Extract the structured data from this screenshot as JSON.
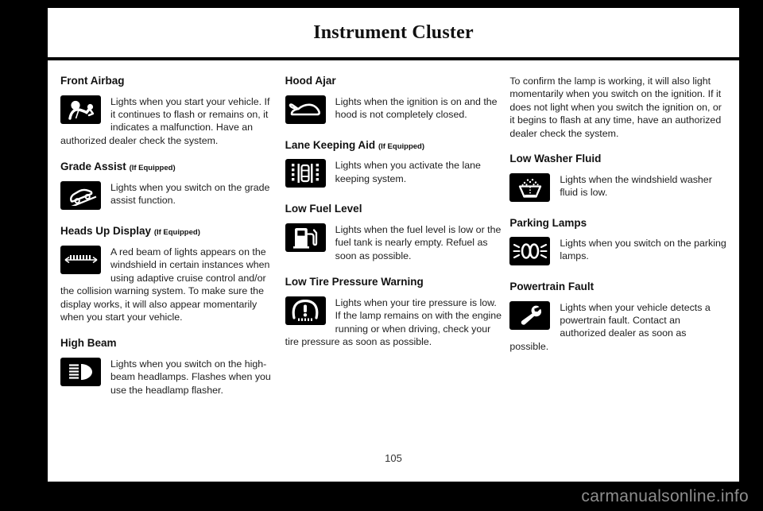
{
  "header": {
    "title": "Instrument Cluster"
  },
  "page_number": "105",
  "watermark": "carmanualsonline.info",
  "columns": [
    {
      "name": "column-1",
      "blocks": [
        {
          "heading": "Front Airbag",
          "if_equipped": "",
          "icon": "airbag-icon",
          "text": "Lights when you start your vehicle. If it continues to flash or remains on, it indicates a malfunction. Have an authorized dealer check the system."
        },
        {
          "heading": "Grade Assist",
          "if_equipped": "(If Equipped)",
          "icon": "grade-assist-icon",
          "text": "Lights when you switch on the grade assist function."
        },
        {
          "heading": "Heads Up Display",
          "if_equipped": "(If Equipped)",
          "icon": "heads-up-display-icon",
          "text": "A red beam of lights appears on the windshield in certain instances when using adaptive cruise control and/or the collision warning system. To make sure the display works, it will also appear momentarily when you start your vehicle."
        },
        {
          "heading": "High Beam",
          "if_equipped": "",
          "icon": "high-beam-icon",
          "text": "Lights when you switch on the high-beam headlamps. Flashes when you use the headlamp flasher."
        }
      ]
    },
    {
      "name": "column-2",
      "blocks": [
        {
          "heading": "Hood Ajar",
          "if_equipped": "",
          "icon": "hood-ajar-icon",
          "text": "Lights when the ignition is on and the hood is not completely closed."
        },
        {
          "heading": "Lane Keeping Aid",
          "if_equipped": "(If Equipped)",
          "icon": "lane-keeping-aid-icon",
          "text": "Lights when you activate the lane keeping system."
        },
        {
          "heading": "Low Fuel Level",
          "if_equipped": "",
          "icon": "low-fuel-level-icon",
          "text": "Lights when the fuel level is low or the fuel tank is nearly empty. Refuel as soon as possible."
        },
        {
          "heading": "Low Tire Pressure Warning",
          "if_equipped": "",
          "icon": "low-tire-pressure-icon",
          "text": "Lights when your tire pressure is low. If the lamp remains on with the engine running or when driving, check your tire pressure as soon as possible."
        }
      ]
    },
    {
      "name": "column-3",
      "intro": "To confirm the lamp is working, it will also light momentarily when you switch on the ignition. If it does not light when you switch the ignition on, or it begins to flash at any time, have an authorized dealer check the system.",
      "blocks": [
        {
          "heading": "Low Washer Fluid",
          "if_equipped": "",
          "icon": "low-washer-fluid-icon",
          "text": "Lights when the windshield washer fluid is low."
        },
        {
          "heading": "Parking Lamps",
          "if_equipped": "",
          "icon": "parking-lamps-icon",
          "text": "Lights when you switch on the parking lamps."
        },
        {
          "heading": "Powertrain Fault",
          "if_equipped": "",
          "icon": "powertrain-fault-icon",
          "text": "Lights when your vehicle detects a powertrain fault. Contact an authorized dealer as soon as possible."
        }
      ]
    }
  ],
  "colors": {
    "page_background": "#ffffff",
    "frame": "#000000",
    "icon_background": "#000000",
    "watermark_text": "#8e8e8e"
  }
}
